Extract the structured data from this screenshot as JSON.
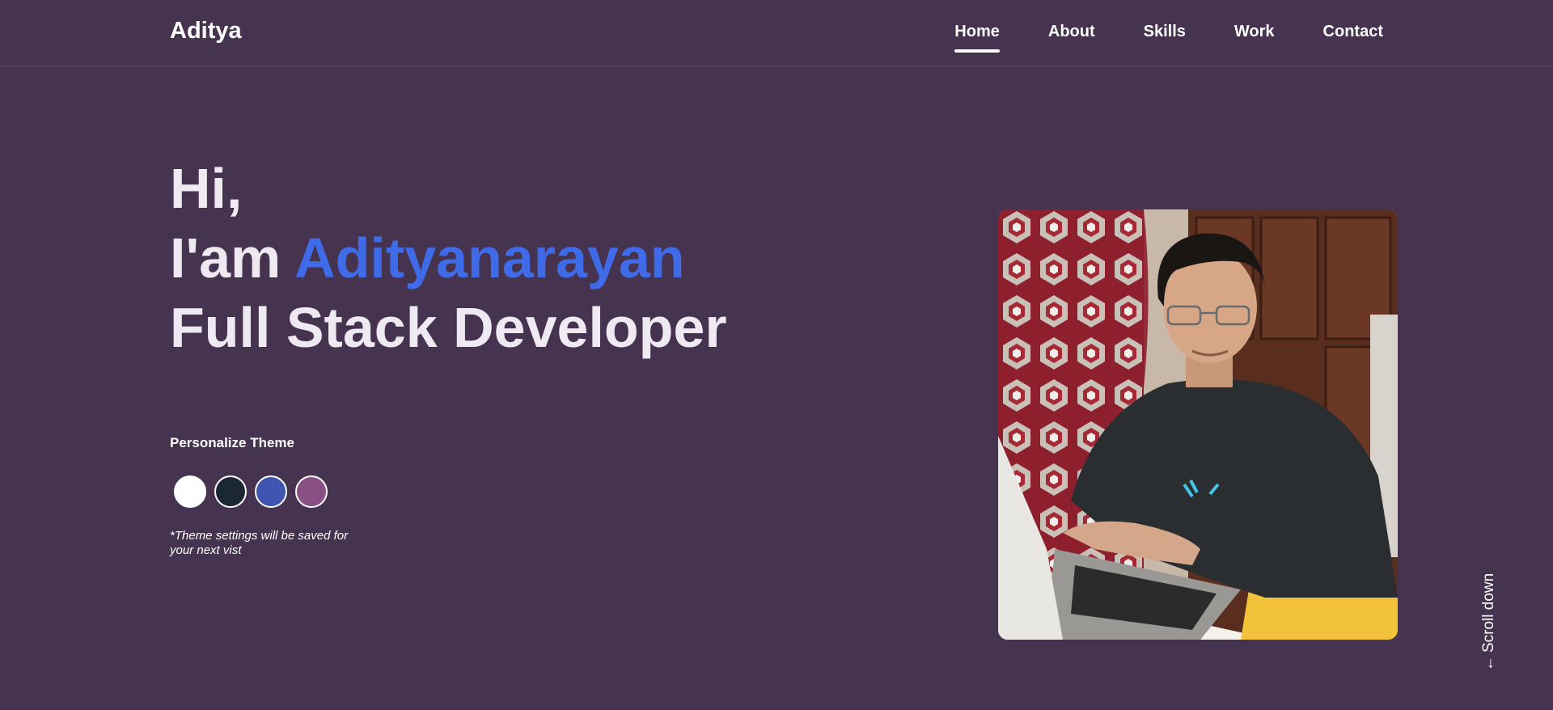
{
  "nav": {
    "brand": "Aditya",
    "links": [
      {
        "label": "Home",
        "active": true
      },
      {
        "label": "About"
      },
      {
        "label": "Skills"
      },
      {
        "label": "Work"
      },
      {
        "label": "Contact"
      }
    ]
  },
  "hero": {
    "greeting": "Hi,",
    "intro_prefix": "I'am ",
    "name": "Adityanarayan",
    "role": "Full Stack Developer"
  },
  "theme": {
    "title": "Personalize Theme",
    "swatches": [
      {
        "name": "white",
        "color": "#ffffff"
      },
      {
        "name": "dark-navy",
        "color": "#1b2735"
      },
      {
        "name": "blue",
        "color": "#3e56b0"
      },
      {
        "name": "purple",
        "color": "#8a4f83"
      }
    ],
    "note": "*Theme settings will be saved for your next vist"
  },
  "profile_photo": {
    "description_icon": "profile-photo"
  },
  "scroll": {
    "arrow": "←",
    "label": "Scroll down"
  },
  "colors": {
    "background": "#45334f",
    "accent": "#3f6ae8",
    "text": "#efe9f2"
  }
}
